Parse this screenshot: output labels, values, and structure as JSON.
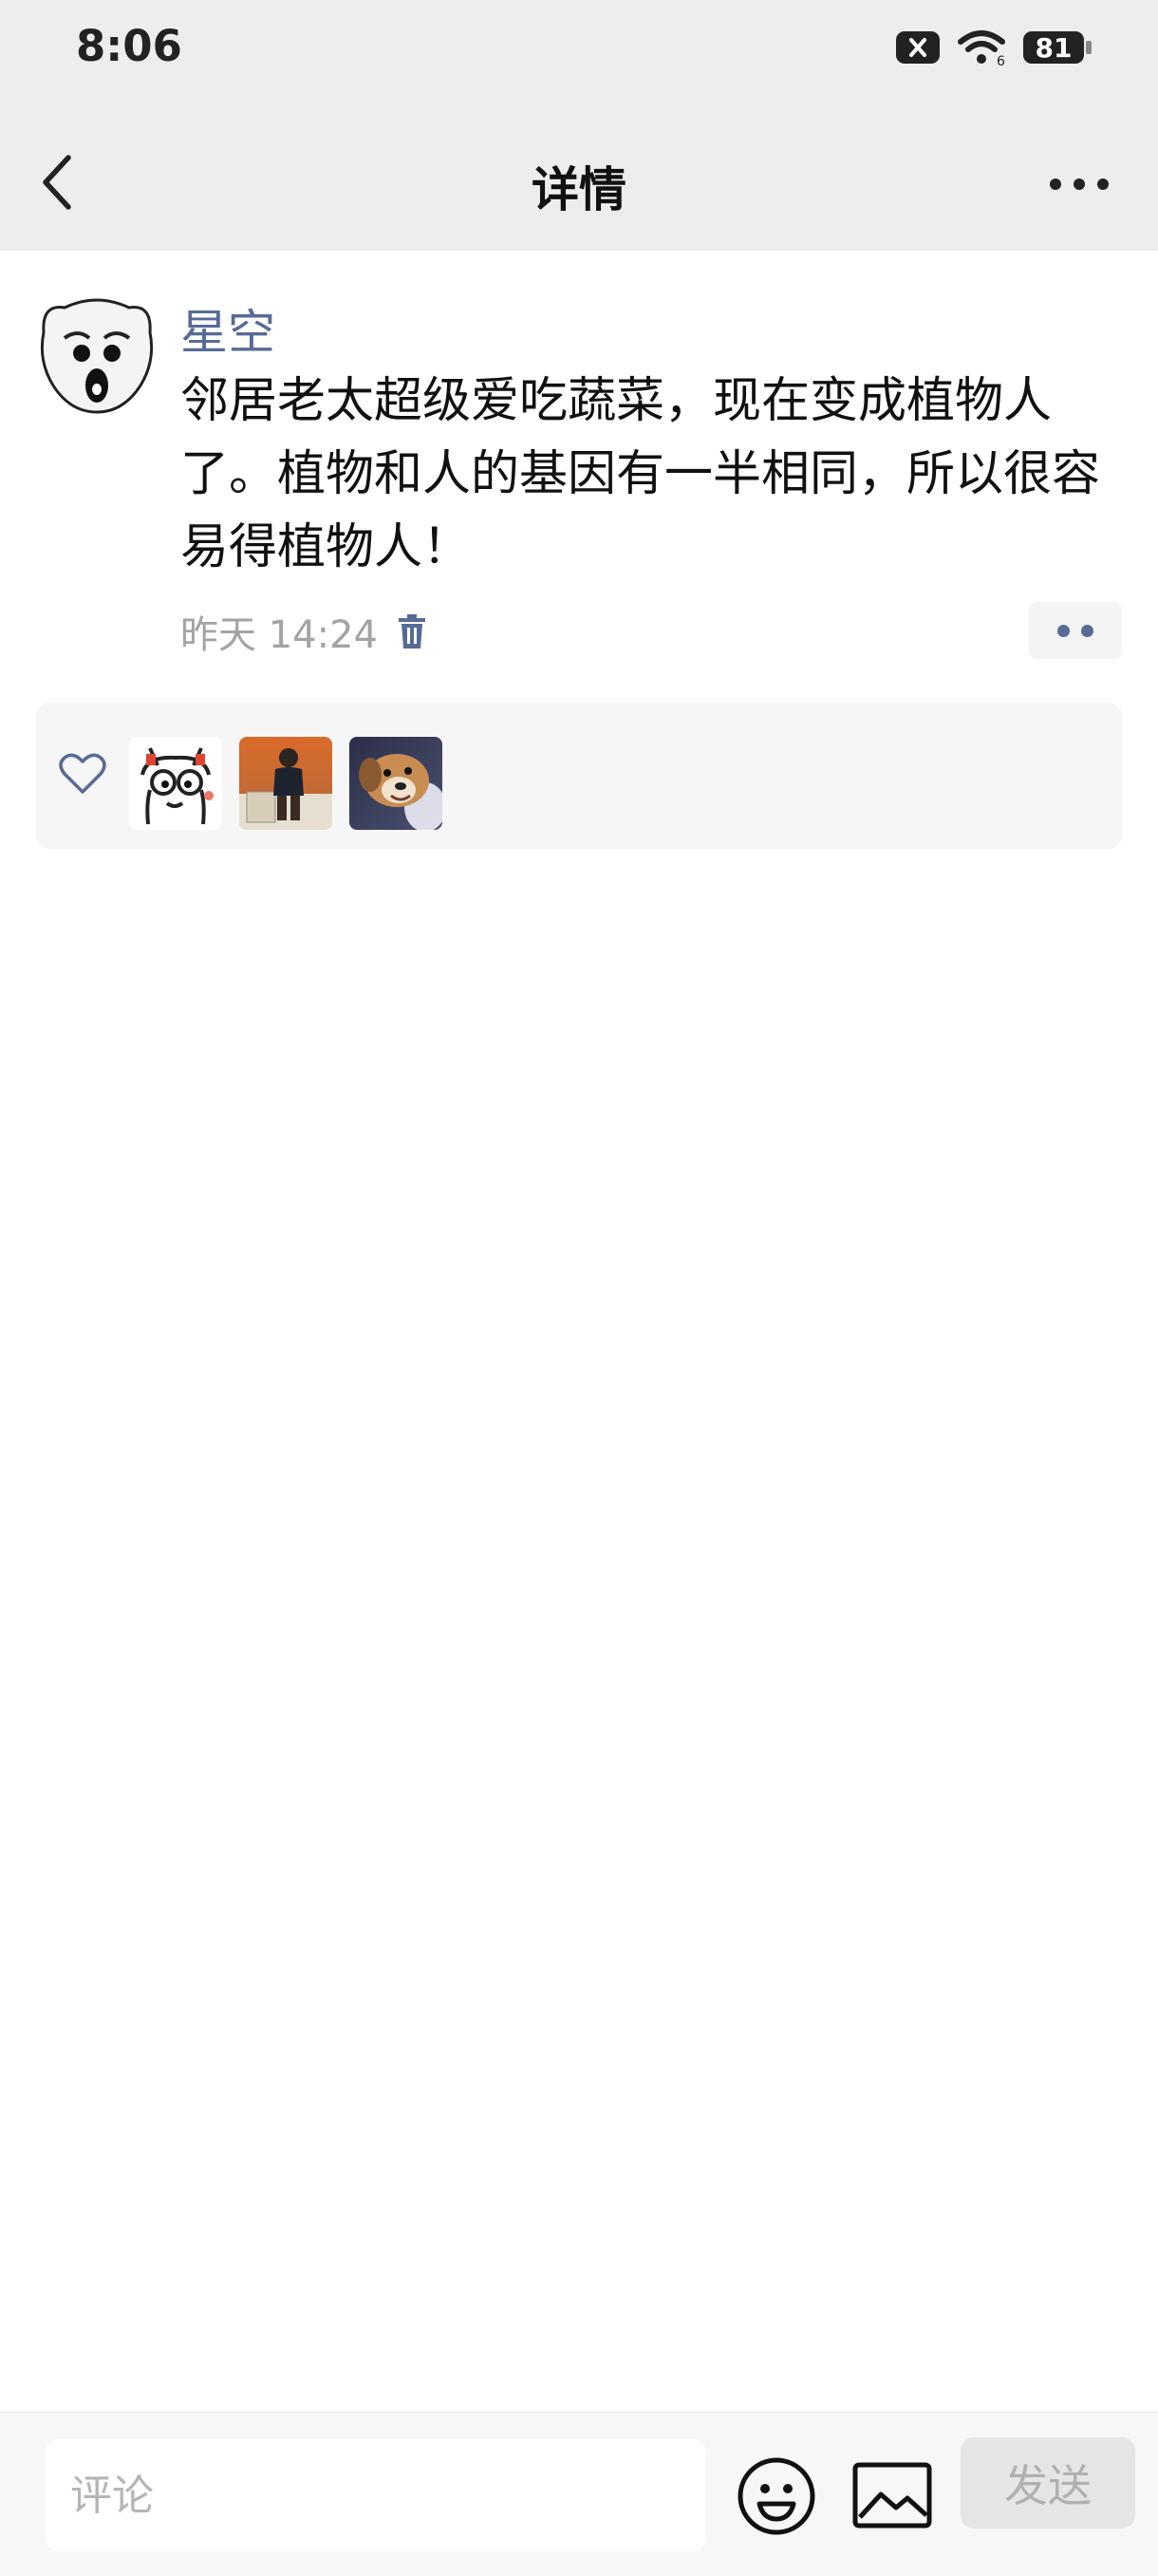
{
  "status_bar": {
    "time": "8:06",
    "battery": "81",
    "icons": [
      "sim-blocked-icon",
      "wifi-icon",
      "battery-icon"
    ]
  },
  "header": {
    "title": "详情",
    "icons": [
      "back-arrow-icon",
      "more-dots-icon"
    ]
  },
  "post": {
    "author": "星空",
    "text": "邻居老太超级爱吃蔬菜，现在变成植物人了。植物和人的基因有一半相同，所以很容易得植物人！",
    "time": "昨天 14:24",
    "icons": [
      "trash-icon",
      "action-dots-icon"
    ]
  },
  "likes": {
    "icon": "heart-outline-icon",
    "avatars": [
      "doodle-face-avatar",
      "child-photo-avatar",
      "dog-photo-avatar"
    ]
  },
  "composer": {
    "placeholder": "评论",
    "send_label": "发送",
    "icons": [
      "emoji-icon",
      "image-icon"
    ]
  },
  "colors": {
    "link": "#576b95",
    "header_bg": "#ededed",
    "likes_bg": "#f6f6f6"
  }
}
